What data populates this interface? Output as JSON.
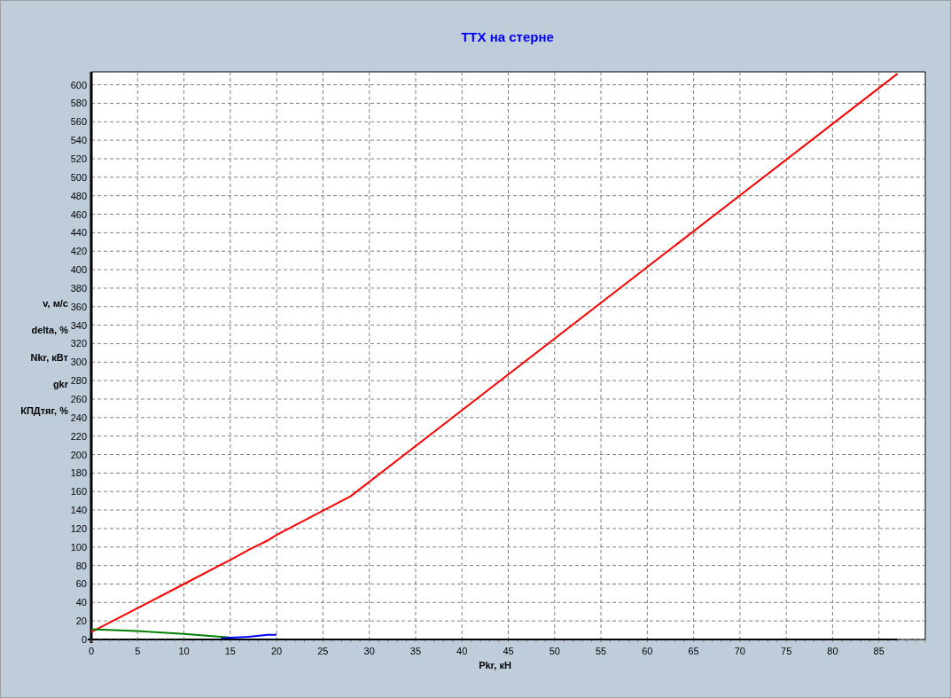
{
  "chart_data": {
    "type": "line",
    "title": "ТТХ на стерне",
    "xlabel": "Pkr, кН",
    "ylabel": [
      "v, м/с",
      "delta, %",
      "Nkr, кВт",
      "gkr",
      "КПДтяг, %"
    ],
    "x": [
      0,
      5,
      10,
      14,
      15,
      17,
      19,
      20,
      28,
      87
    ],
    "series": [
      {
        "color": "#ff0000",
        "values": [
          8,
          34,
          60,
          81,
          86,
          97,
          107,
          113,
          155,
          612
        ]
      },
      {
        "color": "#008000",
        "values": [
          11,
          9,
          6,
          3,
          2,
          null,
          null,
          null,
          null,
          null
        ]
      },
      {
        "color": "#0000ff",
        "values": [
          null,
          null,
          null,
          1,
          2,
          3,
          5,
          5,
          null,
          null
        ]
      },
      {
        "color": "#000000",
        "values": [
          null,
          null,
          0,
          0,
          0,
          0,
          0,
          0,
          0,
          0
        ]
      }
    ],
    "grid": true,
    "xlim": [
      0,
      90
    ],
    "ylim": [
      0,
      614
    ],
    "xticks": [
      0,
      5,
      10,
      15,
      20,
      25,
      30,
      35,
      40,
      45,
      50,
      55,
      60,
      65,
      70,
      75,
      80,
      85
    ],
    "yticks": [
      0,
      20,
      40,
      60,
      80,
      100,
      120,
      140,
      160,
      180,
      200,
      220,
      240,
      260,
      280,
      300,
      320,
      340,
      360,
      380,
      400,
      420,
      440,
      460,
      480,
      500,
      520,
      540,
      560,
      580,
      600
    ]
  }
}
